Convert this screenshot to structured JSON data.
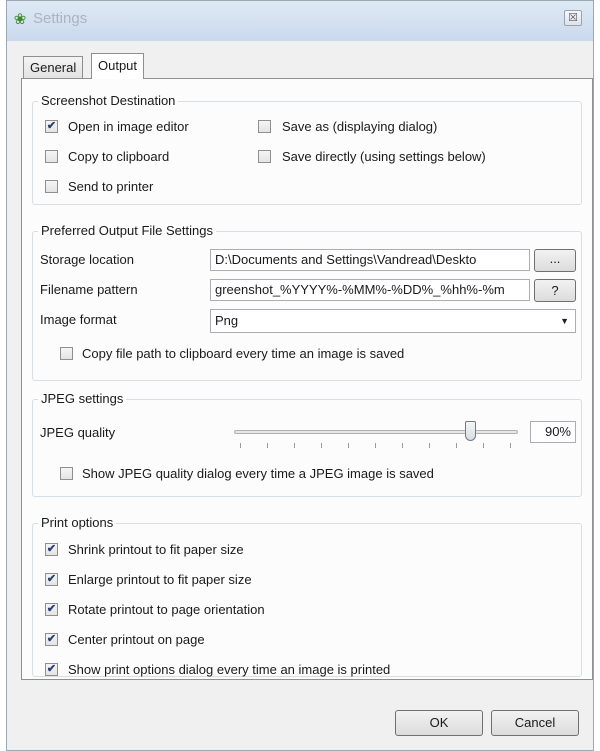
{
  "window": {
    "title": "Settings",
    "close_glyph": "☒",
    "app_icon": "greenshot-icon"
  },
  "tabs": [
    {
      "label": "General",
      "active": false
    },
    {
      "label": "Output",
      "active": true
    }
  ],
  "destination": {
    "label": "Screenshot Destination",
    "open_editor": {
      "label": "Open in image editor",
      "checked": true
    },
    "copy_clipboard": {
      "label": "Copy to clipboard",
      "checked": false
    },
    "send_printer": {
      "label": "Send to printer",
      "checked": false
    },
    "save_as": {
      "label": "Save as (displaying dialog)",
      "checked": false
    },
    "save_direct": {
      "label": "Save directly (using settings below)",
      "checked": false
    }
  },
  "output_file": {
    "label": "Preferred Output File Settings",
    "storage_label": "Storage location",
    "storage_value": "D:\\Documents and Settings\\Vandread\\Deskto",
    "browse_label": "...",
    "filename_label": "Filename pattern",
    "filename_value": "greenshot_%YYYY%-%MM%-%DD%_%hh%-%m",
    "help_label": "?",
    "format_label": "Image format",
    "format_value": "Png",
    "copy_path": {
      "label": "Copy file path to clipboard every time an image is saved",
      "checked": false
    }
  },
  "jpeg": {
    "label": "JPEG settings",
    "quality_label": "JPEG quality",
    "quality_value": "90%",
    "quality_level": 0.9,
    "show_dialog": {
      "label": "Show JPEG quality dialog every time a JPEG image is saved",
      "checked": false
    }
  },
  "print": {
    "label": "Print options",
    "shrink": {
      "label": "Shrink printout to fit paper size",
      "checked": true
    },
    "enlarge": {
      "label": "Enlarge printout to fit paper size",
      "checked": true
    },
    "rotate": {
      "label": "Rotate printout to page orientation",
      "checked": true
    },
    "center": {
      "label": "Center printout on page",
      "checked": true
    },
    "show_dialog": {
      "label": "Show print options dialog every time an image is printed",
      "checked": true
    }
  },
  "footer": {
    "ok_label": "OK",
    "cancel_label": "Cancel"
  }
}
